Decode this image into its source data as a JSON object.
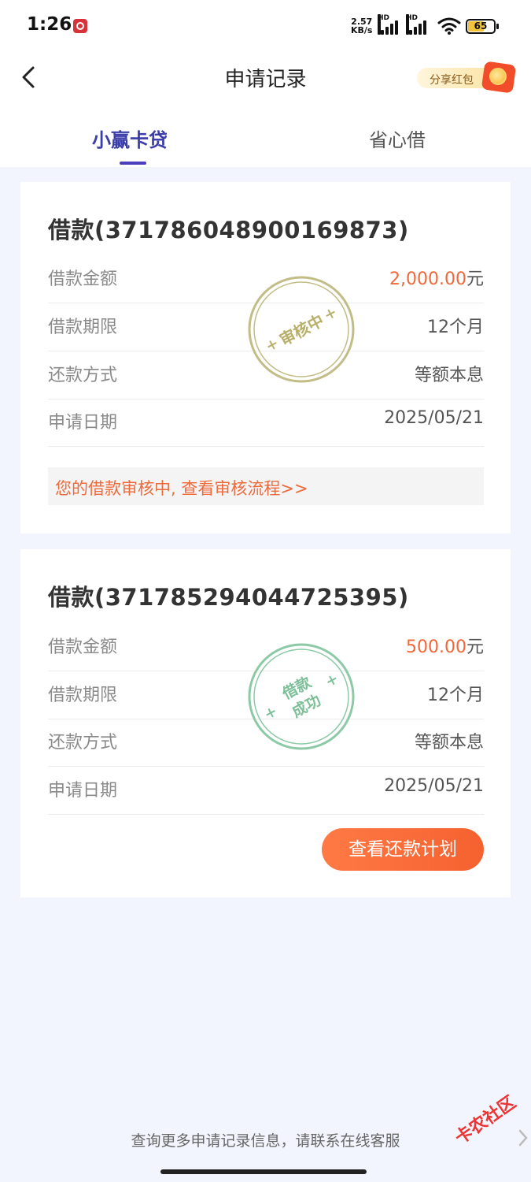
{
  "status_bar": {
    "time": "1:26",
    "net_speed_value": "2.57",
    "net_speed_unit": "KB/s",
    "signal_1_label": "HD",
    "signal_2_label": "HD",
    "battery": "65"
  },
  "nav": {
    "title": "申请记录",
    "share_label": "分享红包"
  },
  "tabs": [
    {
      "label": "小赢卡贷",
      "active": true
    },
    {
      "label": "省心借",
      "active": false
    }
  ],
  "records": [
    {
      "title": "借款(371786048900169873)",
      "stamp_text": "审核中",
      "stamp_color": "#b8b06a",
      "rows": [
        {
          "label": "借款金额",
          "amount": "2,000.00",
          "unit": "元"
        },
        {
          "label": "借款期限",
          "value": "12个月"
        },
        {
          "label": "还款方式",
          "value": "等额本息"
        },
        {
          "label": "申请日期",
          "value": "2025/05/21"
        }
      ],
      "notice": "您的借款审核中, 查看审核流程>>"
    },
    {
      "title": "借款(371785294044725395)",
      "stamp_line1": "借款",
      "stamp_line2": "成功",
      "stamp_color": "#7dbf98",
      "rows": [
        {
          "label": "借款金额",
          "amount": "500.00",
          "unit": "元"
        },
        {
          "label": "借款期限",
          "value": "12个月"
        },
        {
          "label": "还款方式",
          "value": "等额本息"
        },
        {
          "label": "申请日期",
          "value": "2025/05/21"
        }
      ],
      "button": "查看还款计划"
    }
  ],
  "footer": {
    "text": "查询更多申请记录信息，请联系在线客服"
  },
  "watermark": "卡农社区",
  "colors": {
    "accent": "#f2673a",
    "tab_active": "#3b3da8",
    "background": "#f2f5fd"
  }
}
